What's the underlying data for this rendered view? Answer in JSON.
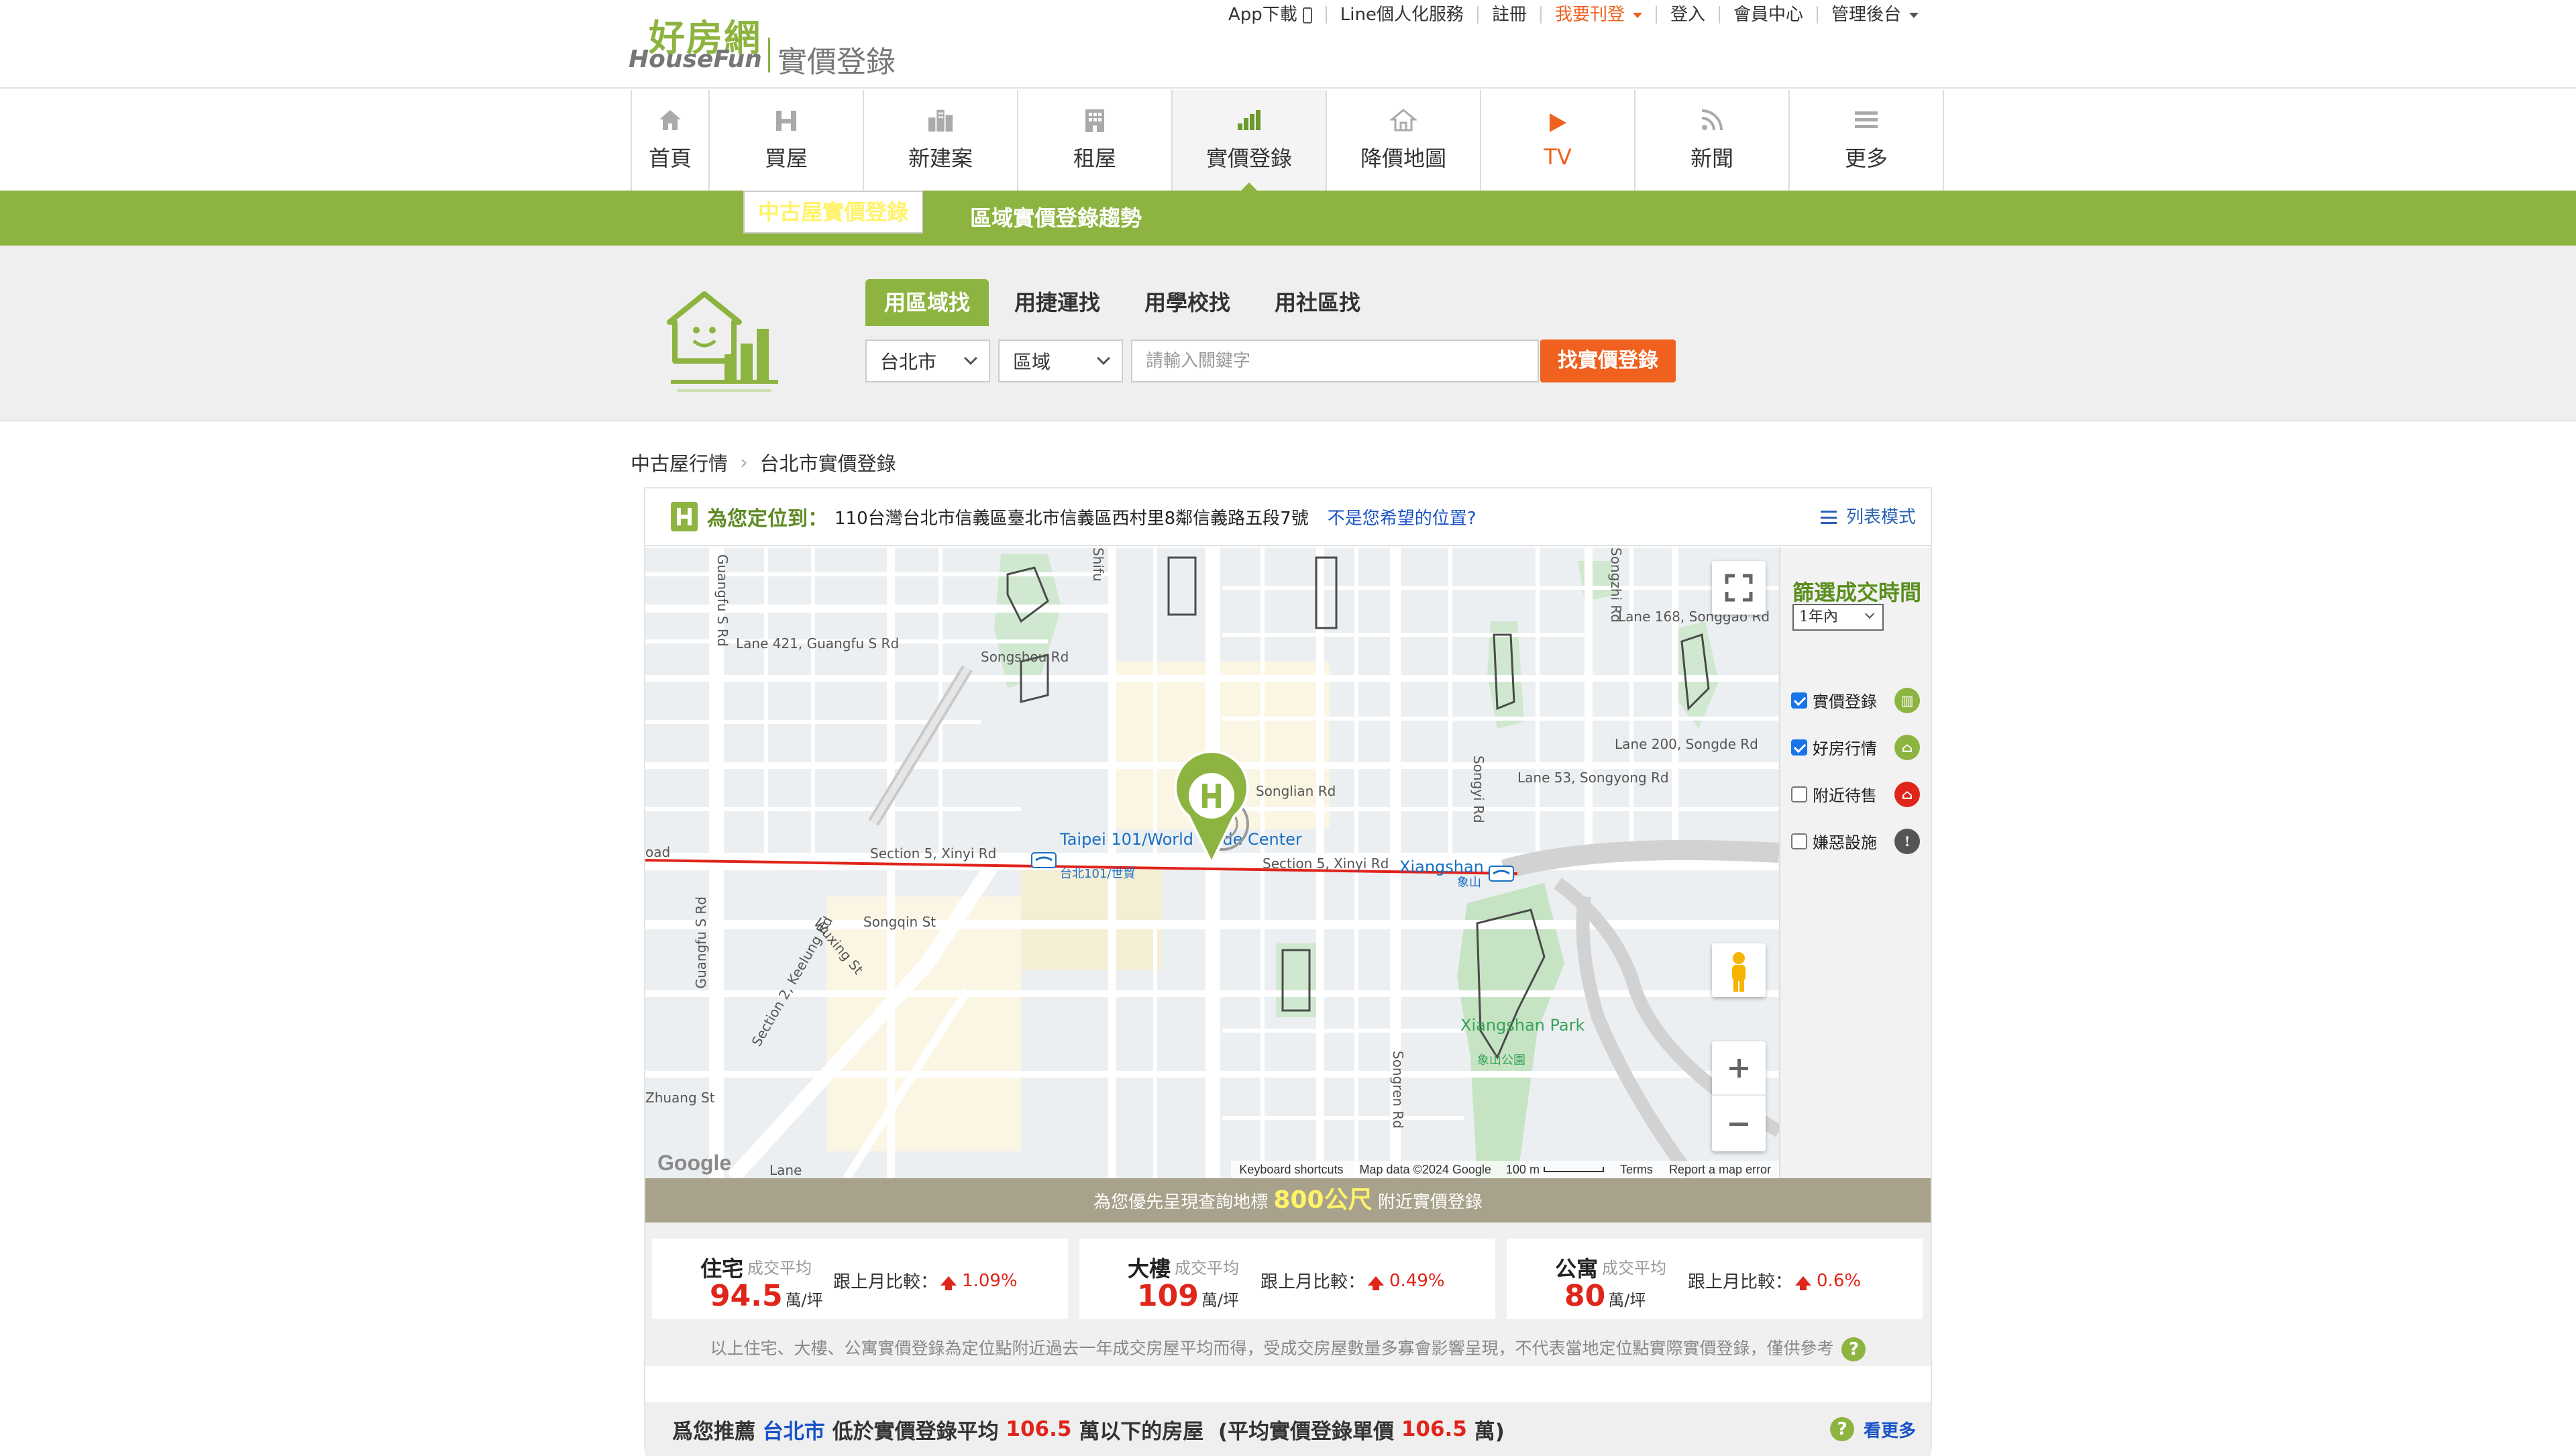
{
  "header": {
    "logo_cn": "好房網",
    "logo_en": "HouseFun",
    "logo_sub": "實價登錄",
    "links": [
      {
        "label": "App下載"
      },
      {
        "label": "Line個人化服務"
      },
      {
        "label": "註冊"
      },
      {
        "label": "我要刊登"
      },
      {
        "label": "登入"
      },
      {
        "label": "會員中心"
      },
      {
        "label": "管理後台"
      }
    ]
  },
  "nav": {
    "items": [
      {
        "label": "首頁",
        "icon": "home-icon"
      },
      {
        "label": "買屋",
        "icon": "house-h-icon"
      },
      {
        "label": "新建案",
        "icon": "buildings-icon"
      },
      {
        "label": "租屋",
        "icon": "apartment-icon"
      },
      {
        "label": "實價登錄",
        "icon": "bar-chart-icon",
        "active": true
      },
      {
        "label": "降價地圖",
        "icon": "house-outline-icon"
      },
      {
        "label": "TV",
        "icon": "play-icon"
      },
      {
        "label": "新聞",
        "icon": "rss-icon"
      },
      {
        "label": "更多",
        "icon": "menu-icon"
      }
    ]
  },
  "subnav": {
    "items": [
      {
        "label": "中古屋實價登錄",
        "selected": true
      },
      {
        "label": "區域實價登錄趨勢"
      }
    ]
  },
  "search": {
    "tabs": [
      "用區域找",
      "用捷運找",
      "用學校找",
      "用社區找"
    ],
    "city": "台北市",
    "district": "區域",
    "keyword_placeholder": "請輸入關鍵字",
    "submit": "找實價登錄"
  },
  "breadcrumb": [
    "中古屋行情",
    "台北市實價登錄"
  ],
  "location": {
    "label": "為您定位到：",
    "address": "110台灣台北市信義區臺北市信義區西村里8鄰信義路五段7號",
    "not_here": "不是您希望的位置?",
    "list_mode": "列表模式"
  },
  "map": {
    "labels": {
      "guangfu": "Guangfu S Rd",
      "lane421": "Lane 421, Guangfu S Rd",
      "songshou": "Songshou Rd",
      "shifu": "Shifu",
      "songgao": "Lane 168, Songgao Rd",
      "songde": "Lane 200, Songde Rd",
      "songyong": "Lane 53, Songyong Rd",
      "songyi": "Songyi Rd",
      "songjiang": "Songzhi Rd",
      "xinyi1": "Section 5, Xinyi Rd",
      "xinyi2": "Section 5, Xinyi Rd",
      "taipei101_en": "Taipei 101/World Trade Center",
      "taipei101_zh": "台北101/世貿",
      "xiangshan_en": "Xiangshan",
      "xiangshan_zh": "象山",
      "songqin": "Songqin St",
      "keelung": "Section 2, Keelung Rd",
      "wuxing": "Wuxing St",
      "guangfu2": "Guangfu S Rd",
      "songren": "Songren Rd",
      "xiangshan_park_en": "Xiangshan Park",
      "xiangshan_park_zh": "象山公園",
      "zhuang": "Zhuang St",
      "lane": "Lane",
      "songlian": "Songlian Rd",
      "oad": "oad"
    },
    "footer": {
      "google": "Google",
      "shortcuts": "Keyboard shortcuts",
      "mapdata": "Map data ©2024 Google",
      "scale": "100 m",
      "terms": "Terms",
      "report": "Report a map error"
    }
  },
  "filter": {
    "title": "篩選成交時間",
    "period": "1年內",
    "options": [
      {
        "label": "實價登錄",
        "checked": true,
        "color": "#8db440"
      },
      {
        "label": "好房行情",
        "checked": true,
        "color": "#8db440"
      },
      {
        "label": "附近待售",
        "checked": false,
        "color": "#e0251a"
      },
      {
        "label": "嫌惡設施",
        "checked": false,
        "color": "#555555"
      }
    ]
  },
  "distance": {
    "prefix": "為您優先呈現查詢地標",
    "value": "800公尺",
    "suffix": "附近實價登錄"
  },
  "stats": [
    {
      "type": "住宅",
      "label": "成交平均",
      "value": "94.5",
      "unit": "萬/坪",
      "cmp_label": "跟上月比較：",
      "cmp": "1.09%"
    },
    {
      "type": "大樓",
      "label": "成交平均",
      "value": "109",
      "unit": "萬/坪",
      "cmp_label": "跟上月比較：",
      "cmp": "0.49%"
    },
    {
      "type": "公寓",
      "label": "成交平均",
      "value": "80",
      "unit": "萬/坪",
      "cmp_label": "跟上月比較：",
      "cmp": "0.6%"
    }
  ],
  "stats_note": "以上住宅、大樓、公寓實價登錄為定位點附近過去一年成交房屋平均而得，受成交房屋數量多寡會影響呈現，不代表當地定位點實際實價登錄，僅供參考",
  "recommend": {
    "p1": "爲您推薦",
    "city": "台北市",
    "p2": "低於實價登錄平均",
    "v1": "106.5",
    "p3": "萬以下的房屋",
    "p4": "(平均實價登錄單價",
    "v2": "106.5",
    "p5": "萬)",
    "more": "看更多"
  },
  "colors": {
    "brand_green": "#8db440",
    "orange": "#f0601e",
    "price_red": "#e0251a",
    "link_blue": "#1a53c6"
  }
}
